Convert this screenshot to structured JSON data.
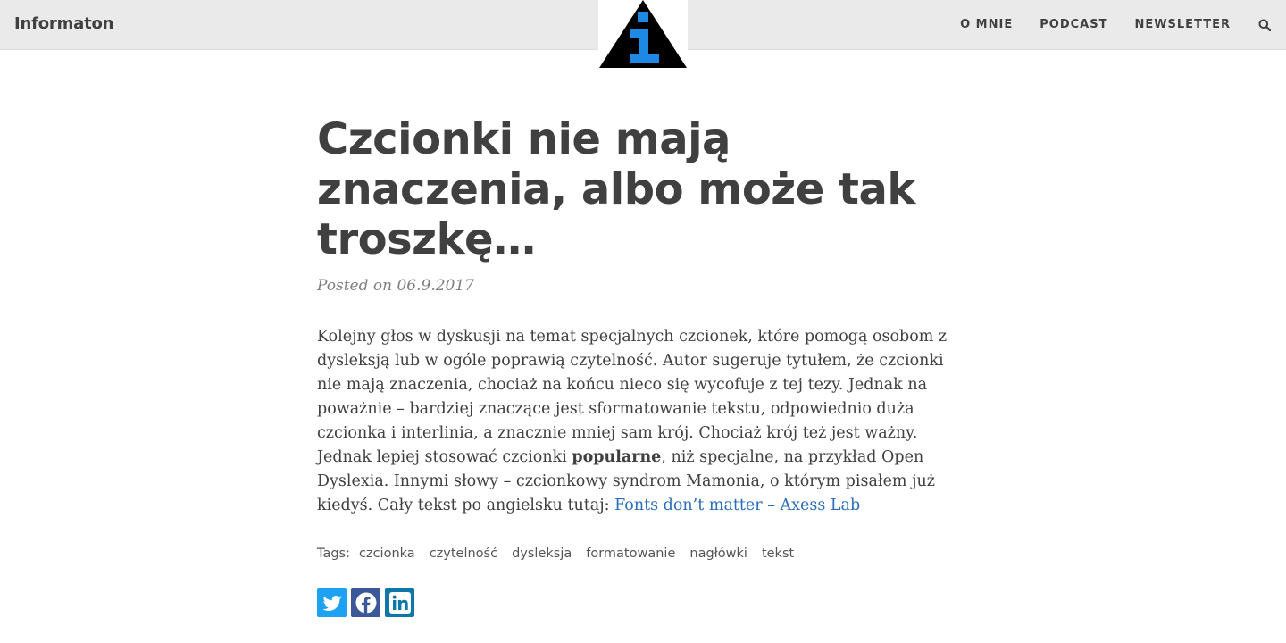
{
  "header": {
    "brand": "Informaton",
    "logo_icon": "information-icon",
    "nav": [
      {
        "label": "O MNIE"
      },
      {
        "label": "PODCAST"
      },
      {
        "label": "NEWSLETTER"
      }
    ],
    "search_icon": "search-icon"
  },
  "post": {
    "title": "Czcionki nie mają znaczenia, albo może tak troszkę…",
    "meta": "Posted on 06.9.2017",
    "body": {
      "text_1": "Kolejny głos w dyskusji na temat specjalnych czcionek, które pomogą osobom z dysleksją lub w ogóle poprawią czytelność. Autor sugeruje tytułem, że czcionki nie mają znaczenia, chociaż na końcu nieco się wycofuje z tej tezy. Jednak na poważnie – bardziej znaczące jest sformatowanie tekstu, odpowiednio duża czcionka i interlinia, a znacznie mniej sam krój. Chociaż krój też jest ważny. Jednak lepiej stosować czcionki ",
      "bold": "popularne",
      "text_2": ", niż specjalne, na przykład Open Dyslexia. Innymi słowy – czcionkowy syndrom Mamonia, o którym pisałem już kiedyś. Cały tekst po angielsku tutaj: ",
      "link": "Fonts don’t matter – Axess Lab"
    },
    "tags_label": "Tags:",
    "tags": [
      "czcionka",
      "czytelność",
      "dysleksja",
      "formatowanie",
      "nagłówki",
      "tekst"
    ],
    "share": [
      {
        "icon": "twitter-icon",
        "color": "#1da1f2"
      },
      {
        "icon": "facebook-icon",
        "color": "#3b5998"
      },
      {
        "icon": "linkedin-icon",
        "color": "#0e76a8"
      }
    ]
  },
  "colors": {
    "navbar_bg": "#eaeaea",
    "text": "#404040",
    "link": "#2a6ebb",
    "logo_blue": "#1e88e5"
  }
}
